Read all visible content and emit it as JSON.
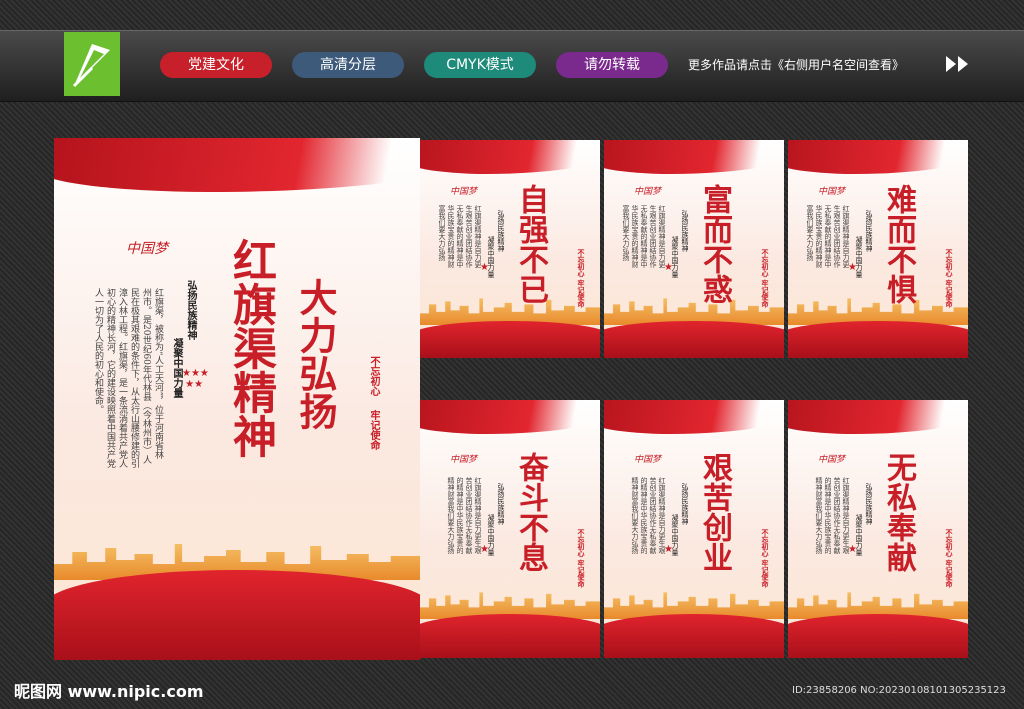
{
  "header": {
    "tags": [
      "党建文化",
      "高清分层",
      "CMYK模式",
      "请勿转载"
    ],
    "more_text": "更多作品请点击《右侧用户名空间查看》",
    "tag_colors": [
      "#c8202b",
      "#3d5a7a",
      "#1d8a7a",
      "#7a2a8c"
    ]
  },
  "main_poster": {
    "title": "红旗渠精神",
    "slogan": "大力弘扬",
    "subtitle_1": "弘扬民族精神",
    "subtitle_2": "凝聚中国力量",
    "body": "红旗渠，被称为“人工天河”，位于河南省林州市。是20世纪60年代林县（今林州市）人民在极其艰难的条件下，从太行山腰修建的引漳入林工程。红旗渠，是一条流淌着共产党人初心的精神长河，它的建设映照着中国共产党人一切为了人民的初心和使命。",
    "seal_1": "不忘初心",
    "seal_2": "牢记使命",
    "dream_mark": "中国梦"
  },
  "small_posters": [
    {
      "title": "自强不已"
    },
    {
      "title": "富而不惑"
    },
    {
      "title": "难而不惧"
    },
    {
      "title": "奋斗不息"
    },
    {
      "title": "艰苦创业"
    },
    {
      "title": "无私奉献"
    }
  ],
  "small_common": {
    "subtitle_1": "弘扬民族精神",
    "subtitle_2": "凝聚中国力量",
    "body": "红旗渠精神是自力更生艰苦创业团结协作无私奉献的精神是中华民族宝贵的精神财富我们要大力弘扬",
    "seal": "不忘初心 牢记使命",
    "dream_mark": "中国梦"
  },
  "footer": {
    "brand": "昵图网 www.nipic.com",
    "id_text": "ID:23858206 NO:20230108101305235123"
  }
}
